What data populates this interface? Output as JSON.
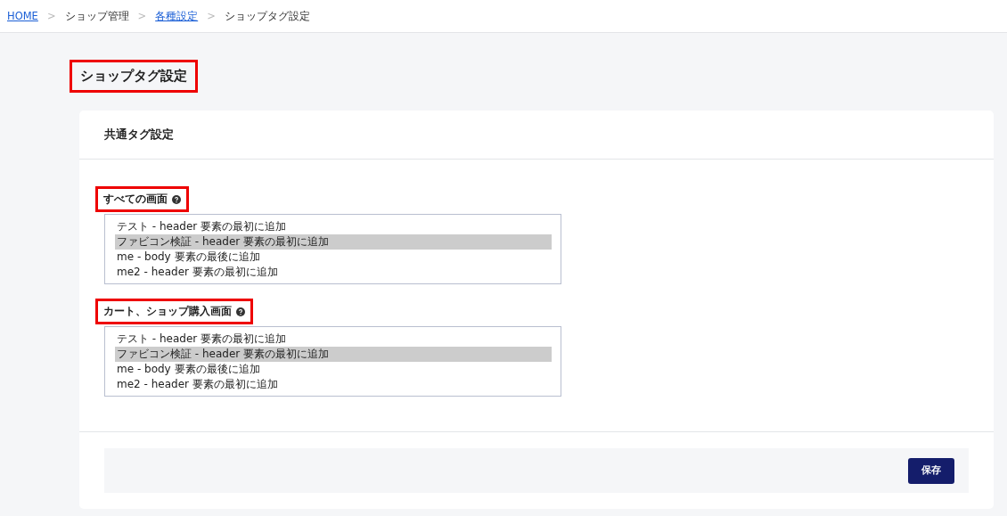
{
  "breadcrumb_separator": ">",
  "breadcrumb": [
    {
      "label": "HOME",
      "link": true
    },
    {
      "label": "ショップ管理",
      "link": false
    },
    {
      "label": "各種設定",
      "link": true
    },
    {
      "label": "ショップタグ設定",
      "link": false
    }
  ],
  "page_title": {
    "text": "ショップタグ設定",
    "highlighted": true
  },
  "card": {
    "title": "共通タグ設定",
    "groups": [
      {
        "label": "すべての画面",
        "highlighted": true,
        "help": true,
        "options": [
          {
            "text": "テスト - header 要素の最初に追加",
            "selected": false
          },
          {
            "text": "ファビコン検証 - header 要素の最初に追加",
            "selected": true
          },
          {
            "text": "me - body 要素の最後に追加",
            "selected": false
          },
          {
            "text": "me2 - header 要素の最初に追加",
            "selected": false
          }
        ]
      },
      {
        "label": "カート、ショップ購入画面",
        "highlighted": true,
        "help": true,
        "options": [
          {
            "text": "テスト - header 要素の最初に追加",
            "selected": false
          },
          {
            "text": "ファビコン検証 - header 要素の最初に追加",
            "selected": true
          },
          {
            "text": "me - body 要素の最後に追加",
            "selected": false
          },
          {
            "text": "me2 - header 要素の最初に追加",
            "selected": false
          }
        ]
      }
    ],
    "save_button": "保存"
  }
}
